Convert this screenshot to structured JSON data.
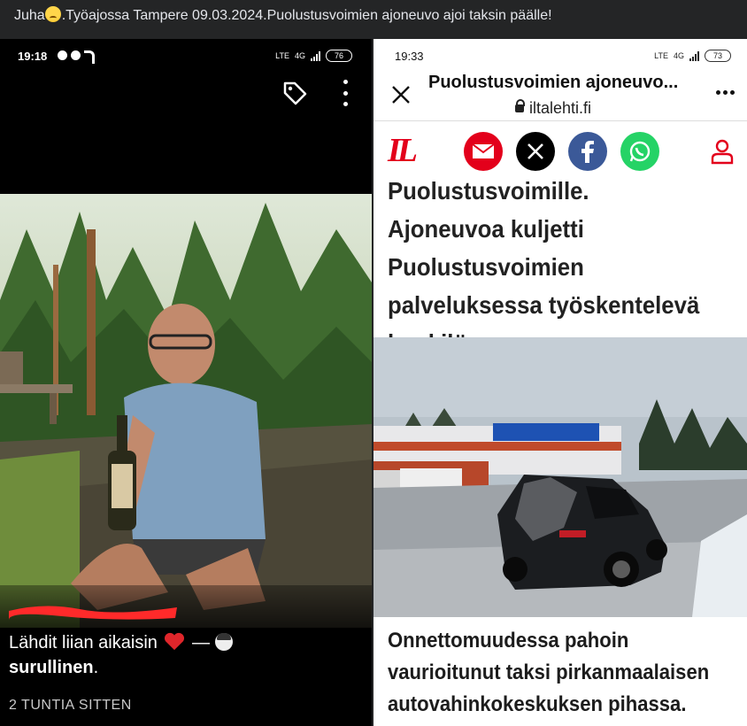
{
  "post": {
    "caption_name": "Juha",
    "caption_text": ".Työajossa Tampere 09.03.2024.Puolustusvoimien ajoneuvo ajoi taksin päälle!",
    "emoji": "sad-face-emoji"
  },
  "left_screenshot": {
    "status_time": "19:18",
    "status_network": "4G",
    "status_lte": "LTE",
    "battery": "76",
    "story_line1": "Lähdit liian aikaisin",
    "story_dash": " — ",
    "story_line2": "surullinen",
    "story_period": ".",
    "time_ago": "2 TUNTIA SITTEN",
    "icons": [
      "messenger-icon",
      "messenger-icon",
      "tiktok-icon",
      "tag-icon",
      "kebab-menu-icon",
      "red-heart-emoji",
      "face-emoji"
    ]
  },
  "right_screenshot": {
    "status_time": "19:33",
    "status_network": "4G",
    "status_lte": "LTE",
    "battery": "73",
    "page_title": "Puolustusvoimien ajoneuvo...",
    "url": "iltalehti.fi",
    "logo": "IL",
    "article_text": "Puolustusvoimille. Ajoneuvoa kuljetti Puolustusvoimien palveluksessa työskentelevä henkilö.",
    "photo_caption": "Onnettomuudessa pahoin vaurioitunut taksi pirkanmaalaisen autovahinkokeskuksen pihassa.",
    "share_icons": [
      "email-share-icon",
      "x-share-icon",
      "facebook-share-icon",
      "whatsapp-share-icon"
    ],
    "colors": {
      "brand_red": "#e3001b",
      "facebook": "#3b5998",
      "whatsapp": "#25d366",
      "email": "#e3001b",
      "x": "#000000"
    }
  }
}
